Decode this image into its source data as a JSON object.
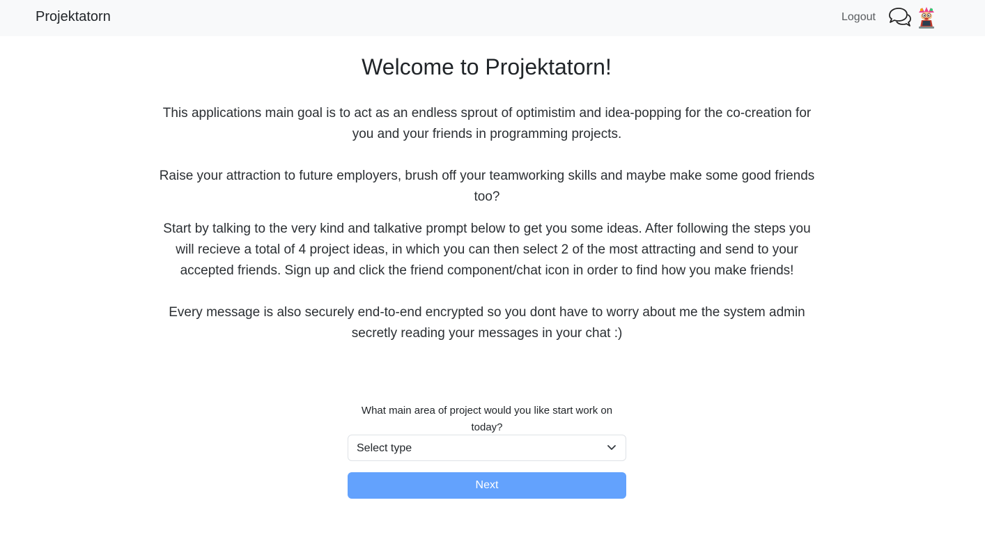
{
  "navbar": {
    "brand": "Projektatorn",
    "logout_label": "Logout",
    "chat_icon": "chat-bubbles-icon",
    "avatar_icon": "cartoon-avatar-icon"
  },
  "main": {
    "title": "Welcome to Projektatorn!",
    "paragraphs": [
      "This applications main goal is to act as an endless sprout of optimistim and idea-popping for the co-creation for you and your friends in programming projects.",
      "Raise your attraction to future employers, brush off your teamworking skills and maybe make some good friends too?",
      "Start by talking to the very kind and talkative prompt below to get you some ideas. After following the steps you will recieve a total of 4 project ideas, in which you can then select 2 of the most attracting and send to your accepted friends. Sign up and click the friend component/chat icon in order to find how you make friends!",
      "Every message is also securely end-to-end encrypted so you dont have to worry about me the system admin secretly reading your messages in your chat :)"
    ]
  },
  "form": {
    "question": "What main area of project would you like start work on today?",
    "select_value": "Select type",
    "next_label": "Next"
  },
  "colors": {
    "navbar_bg": "#f8f9fa",
    "button_bg": "#63a2fd"
  }
}
